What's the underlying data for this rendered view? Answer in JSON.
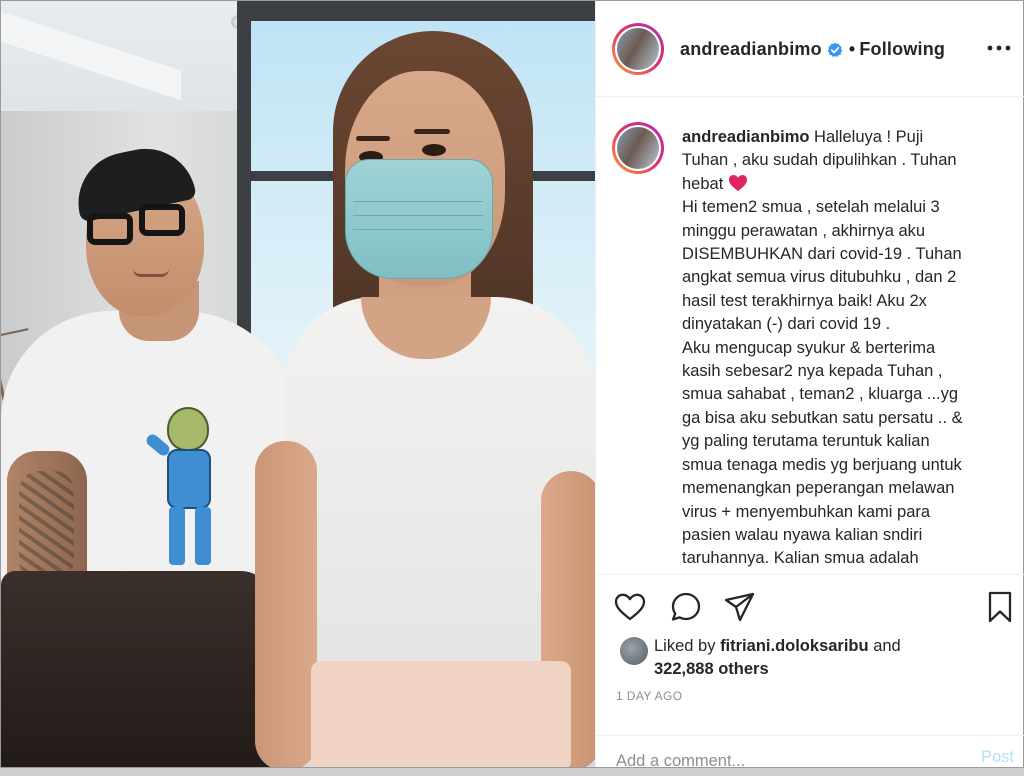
{
  "post": {
    "username": "andreadianbimo",
    "follow_status": "Following",
    "separator": "•",
    "caption_lines": [
      "Halleluya ! Puji",
      "Tuhan , aku sudah dipulihkan . Tuhan",
      "hebat",
      "Hi temen2 smua , setelah melalui 3",
      "minggu perawatan , akhirnya aku",
      "DISEMBUHKAN dari covid-19 . Tuhan",
      "angkat semua virus ditubuhku , dan 2",
      "hasil test terakhirnya baik! Aku 2x",
      "dinyatakan (-) dari covid 19 .",
      "Aku mengucap syukur & berterima",
      "kasih sebesar2 nya kepada Tuhan ,",
      "smua sahabat , teman2 , kluarga ...yg",
      "ga bisa aku sebutkan satu persatu .. &",
      "yg paling terutama teruntuk kalian",
      "smua tenaga medis yg berjuang untuk",
      "memenangkan peperangan melawan",
      "virus + menyembuhkan kami para",
      "pasien walau nyawa kalian sndiri",
      "taruhannya. Kalian smua adalah"
    ],
    "liked_by_prefix": "Liked by",
    "liked_by_user": "fitriani.doloksaribu",
    "liked_by_and": "and",
    "liked_by_count": "322,888 others",
    "timestamp": "1 DAY AGO",
    "comment_placeholder": "Add a comment...",
    "post_button": "Post"
  },
  "icons": {
    "verified": "verified-badge-icon",
    "more": "more-options-icon",
    "like": "heart-icon",
    "comment": "comment-bubble-icon",
    "share": "paper-plane-icon",
    "save": "bookmark-icon",
    "heart_emoji": "red-heart-emoji"
  },
  "colors": {
    "verified_blue": "#3897f0",
    "heart_red": "#e0245e",
    "post_button": "#b2dffc",
    "muted_text": "#8e8e8e"
  }
}
